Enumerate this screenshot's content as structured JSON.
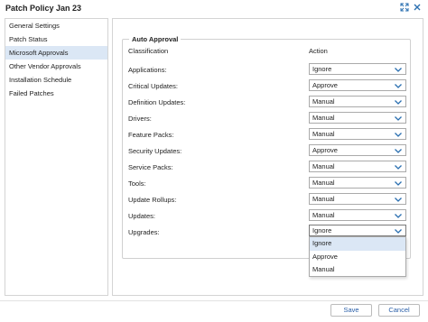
{
  "window": {
    "title": "Patch Policy Jan 23"
  },
  "sidebar": {
    "items": [
      {
        "label": "General Settings"
      },
      {
        "label": "Patch Status"
      },
      {
        "label": "Microsoft Approvals",
        "active": true
      },
      {
        "label": "Other Vendor Approvals"
      },
      {
        "label": "Installation Schedule"
      },
      {
        "label": "Failed Patches"
      }
    ]
  },
  "approval": {
    "group_title": "Auto Approval",
    "col_classification": "Classification",
    "col_action": "Action",
    "rows": [
      {
        "label": "Applications:",
        "value": "Ignore"
      },
      {
        "label": "Critical Updates:",
        "value": "Approve"
      },
      {
        "label": "Definition Updates:",
        "value": "Manual"
      },
      {
        "label": "Drivers:",
        "value": "Manual"
      },
      {
        "label": "Feature Packs:",
        "value": "Manual"
      },
      {
        "label": "Security Updates:",
        "value": "Approve"
      },
      {
        "label": "Service Packs:",
        "value": "Manual"
      },
      {
        "label": "Tools:",
        "value": "Manual"
      },
      {
        "label": "Update Rollups:",
        "value": "Manual"
      },
      {
        "label": "Updates:",
        "value": "Manual"
      },
      {
        "label": "Upgrades:",
        "value": "Ignore"
      }
    ],
    "dropdown_options": [
      "Ignore",
      "Approve",
      "Manual"
    ],
    "dropdown_selected": "Ignore"
  },
  "footer": {
    "save_label": "Save",
    "cancel_label": "Cancel"
  },
  "colors": {
    "accent": "#2a5fa8",
    "selected_bg": "#dbe7f5",
    "chevron": "#2a6fb0"
  },
  "icons": {
    "expand": "expand-icon",
    "close": "close-icon",
    "chevron": "chevron-down-icon"
  }
}
